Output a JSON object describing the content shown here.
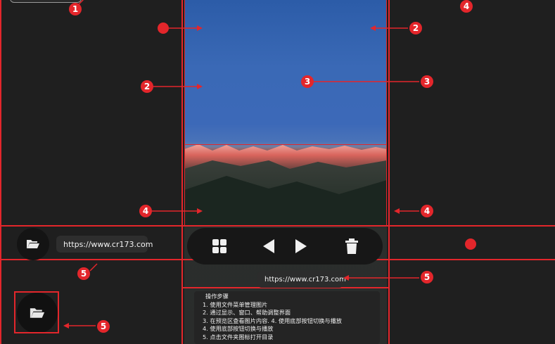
{
  "url_text": "https://www.cr173.com",
  "bottom_bar": {
    "url_label": "https://www.cr173.com"
  },
  "preview": {
    "url_label": "https://www.cr173.com"
  },
  "help": {
    "title": "操作步骤",
    "steps": [
      "1. 使用文件菜单管理图片",
      "2. 通过显示、窗口、帮助调整界面",
      "3. 在预览区查看图片内容.   4. 使用底部按钮切换与播放",
      "4. 使用底部按钮切换与播放",
      "5. 点击文件夹图标打开目录"
    ]
  },
  "badges": [
    "1",
    "2",
    "2",
    "3",
    "3",
    "4",
    "4",
    "4",
    "5",
    "5",
    "5"
  ],
  "icons": {
    "folder": "folder-open-icon",
    "grid": "grid-icon",
    "prev": "triangle-left-icon",
    "next": "triangle-right-icon",
    "trash": "trash-icon"
  },
  "colors": {
    "background": "#1f1f1f",
    "annotation_red": "#e3262b",
    "toolbar": "#171717",
    "sky": "#3a69b6"
  }
}
